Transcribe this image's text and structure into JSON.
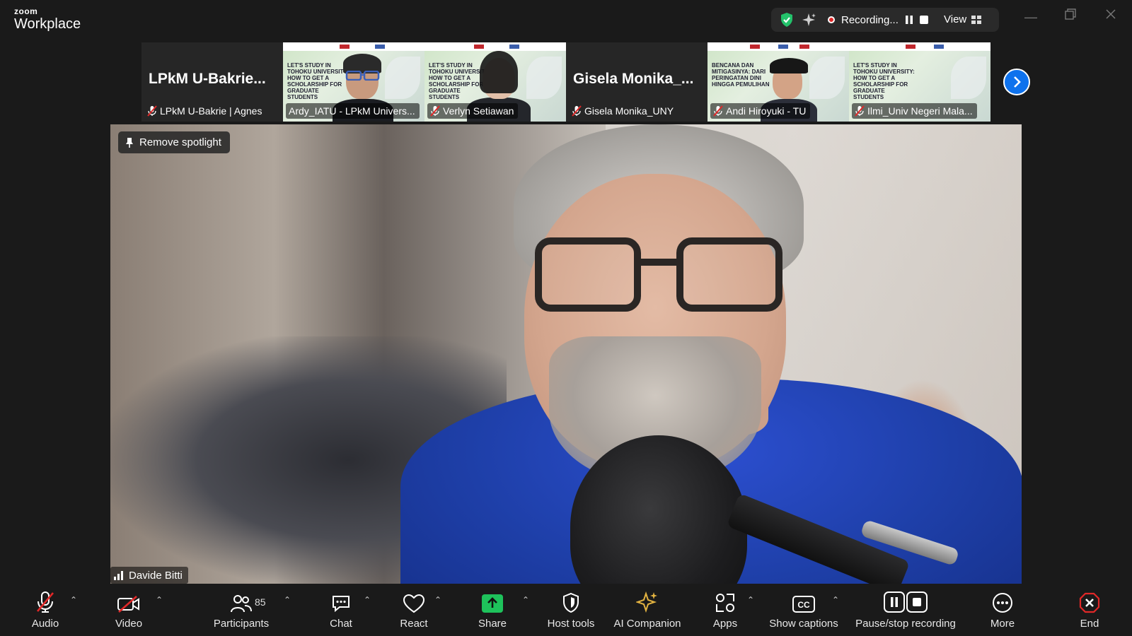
{
  "app": {
    "logo_small": "zoom",
    "logo_big": "Workplace"
  },
  "status": {
    "recording_text": "Recording...",
    "view_label": "View"
  },
  "filmstrip": [
    {
      "display_name": "LPkM U-Bakrie...",
      "label": "LPkM U-Bakrie | Agnes",
      "muted": true,
      "video": false
    },
    {
      "label": "Ardy_IATU - LPkM Univers...",
      "muted": false,
      "video": true,
      "slide_text": "LET'S STUDY IN TOHOKU UNIVERSITY HOW TO GET A SCHOLARSHIP FOR GRADUATE STUDENTS"
    },
    {
      "label": "Verlyn Setiawan",
      "muted": true,
      "video": true,
      "slide_text": "LET'S STUDY IN TOHOKU UNIVERSITY HOW TO GET A SCHOLARSHIP FOR GRADUATE STUDENTS"
    },
    {
      "display_name": "Gisela Monika_...",
      "label": "Gisela Monika_UNY",
      "muted": true,
      "video": false
    },
    {
      "label": "Andi Hiroyuki - TU",
      "muted": true,
      "video": true,
      "slide_text": "BENCANA DAN MITIGASINYA: DARI PERINGATAN DINI HINGGA PEMULIHAN"
    },
    {
      "label": "Ilmi_Univ Negeri Mala...",
      "muted": true,
      "video": true,
      "slide_text": "LET'S STUDY IN TOHOKU UNIVERSITY: HOW TO GET A SCHOLARSHIP FOR GRADUATE STUDENTS"
    }
  ],
  "main": {
    "spotlight_label": "Remove spotlight",
    "speaker_name": "Davide Bitti"
  },
  "toolbar": {
    "audio": "Audio",
    "video": "Video",
    "participants": "Participants",
    "participants_count": "85",
    "chat": "Chat",
    "react": "React",
    "share": "Share",
    "host_tools": "Host tools",
    "ai_companion": "AI Companion",
    "apps": "Apps",
    "show_captions": "Show captions",
    "pause_stop": "Pause/stop recording",
    "more": "More",
    "end": "End"
  },
  "colors": {
    "accent_blue": "#0e72ed",
    "share_green": "#1ec25b",
    "ai_gold": "#e3b341",
    "end_red": "#e02828",
    "mute_red": "#e02828"
  }
}
